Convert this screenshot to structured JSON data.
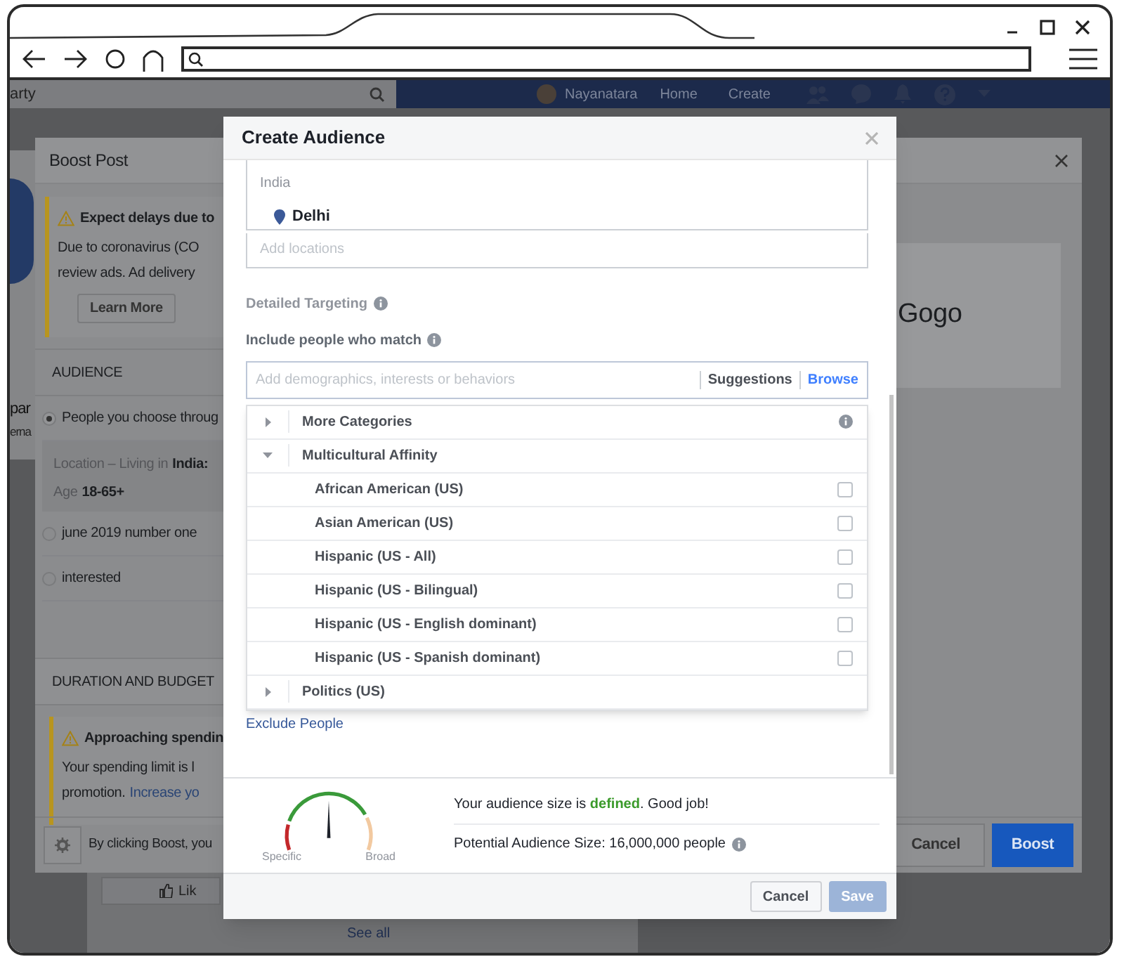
{
  "nav": {
    "search_value": "arty",
    "user_name": "Nayanatara",
    "links": [
      "Home",
      "Create"
    ]
  },
  "page_behind": {
    "profile_texts": [
      "par",
      "erna"
    ],
    "like_label": "Lik",
    "see_all": "See all"
  },
  "boost_post": {
    "title": "Boost Post",
    "notice": {
      "title": "Expect delays due to",
      "lines": [
        "Due to coronavirus (CO",
        "review ads. Ad delivery"
      ],
      "button": "Learn More"
    },
    "audience_heading": "AUDIENCE",
    "audience_options": [
      {
        "label": "People you choose throug",
        "selected": true
      },
      {
        "label": "june 2019 number one",
        "selected": false
      },
      {
        "label": "interested",
        "selected": false
      }
    ],
    "audience_summary": [
      {
        "label": "Location – Living in",
        "value": "India:"
      },
      {
        "label": "Age",
        "value": "18-65+"
      }
    ],
    "duration_heading": "DURATION AND BUDGET",
    "spending_notice": {
      "title": "Approaching spendin",
      "line": "Your spending limit is l",
      "last_line": "promotion.",
      "link": "Increase yo"
    },
    "preview_text": "Gogo",
    "footer_text": "By clicking Boost, you",
    "cancel": "Cancel",
    "boost": "Boost"
  },
  "create_audience": {
    "title": "Create Audience",
    "location_country": "India",
    "locations": [
      "Delhi"
    ],
    "add_locations_placeholder": "Add locations",
    "detailed_targeting_label": "Detailed Targeting",
    "include_label": "Include people who match",
    "targeting_placeholder": "Add demographics, interests or behaviors",
    "suggestions": "Suggestions",
    "browse": "Browse",
    "categories": [
      {
        "label": "More Categories",
        "expanded": false,
        "info": true
      },
      {
        "label": "Multicultural Affinity",
        "expanded": true,
        "children": [
          {
            "label": "African American (US)",
            "checked": false
          },
          {
            "label": "Asian American (US)",
            "checked": false
          },
          {
            "label": "Hispanic (US - All)",
            "checked": false
          },
          {
            "label": "Hispanic (US - Bilingual)",
            "checked": false
          },
          {
            "label": "Hispanic (US - English dominant)",
            "checked": false
          },
          {
            "label": "Hispanic (US - Spanish dominant)",
            "checked": false
          }
        ]
      },
      {
        "label": "Politics (US)",
        "expanded": false
      }
    ],
    "exclude_link": "Exclude People",
    "gauge": {
      "low_label": "Specific",
      "high_label": "Broad"
    },
    "audience_status": "Your audience size is **defined**. Good job!",
    "potential_size": "Potential Audience Size: 16,000,000 people",
    "buttons": [
      {
        "label": "Cancel",
        "disabled": false
      },
      {
        "label": "Save",
        "disabled": true
      }
    ]
  }
}
